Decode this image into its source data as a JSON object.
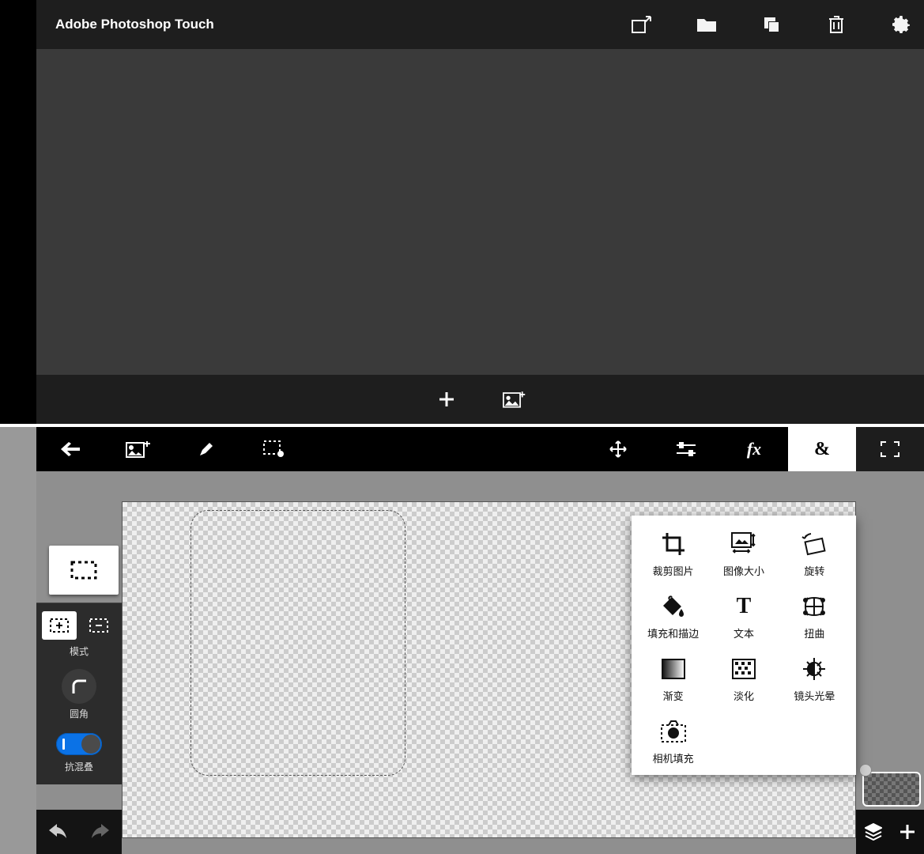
{
  "app": {
    "title": "Adobe Photoshop Touch"
  },
  "toolbar": {
    "share": "share-icon",
    "folder": "folder-icon",
    "copy": "copy-icon",
    "trash": "trash-icon",
    "settings": "settings-icon",
    "add": "add-icon",
    "addimage": "add-image-icon"
  },
  "editor": {
    "left": {
      "back": "back",
      "addimg": "add-image",
      "brush": "brush",
      "selset": "selection-settings"
    },
    "right": {
      "move": "move",
      "adjust": "adjust",
      "fx": "fx",
      "amp": "&",
      "full": "fullscreen"
    },
    "seltool": {
      "mode_label": "模式",
      "round_label": "圆角",
      "anti_label": "抗混叠"
    },
    "amp_menu": {
      "items": [
        {
          "k": "crop",
          "label": "裁剪图片"
        },
        {
          "k": "imgsize",
          "label": "图像大小"
        },
        {
          "k": "rotate",
          "label": "旋转"
        },
        {
          "k": "fillstroke",
          "label": "填充和描边"
        },
        {
          "k": "text",
          "label": "文本"
        },
        {
          "k": "warp",
          "label": "扭曲"
        },
        {
          "k": "gradient",
          "label": "渐变"
        },
        {
          "k": "fade",
          "label": "淡化"
        },
        {
          "k": "lensflare",
          "label": "镜头光晕"
        },
        {
          "k": "camfill",
          "label": "相机填充"
        }
      ]
    }
  }
}
